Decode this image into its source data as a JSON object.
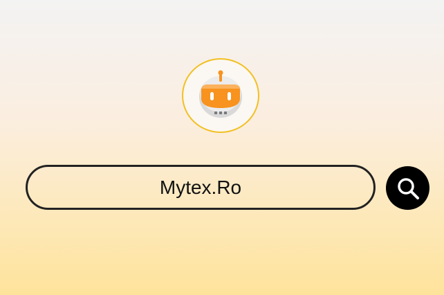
{
  "logo": {
    "icon": "robot-icon",
    "accent_color": "#f7931e",
    "ring_color": "#f2c022"
  },
  "search": {
    "value": "Mytex.Ro",
    "button_icon": "search-icon"
  },
  "colors": {
    "background_top": "#f3f3f3",
    "background_bottom": "#fee39b",
    "field_border": "#222222",
    "button_background": "#000000"
  }
}
